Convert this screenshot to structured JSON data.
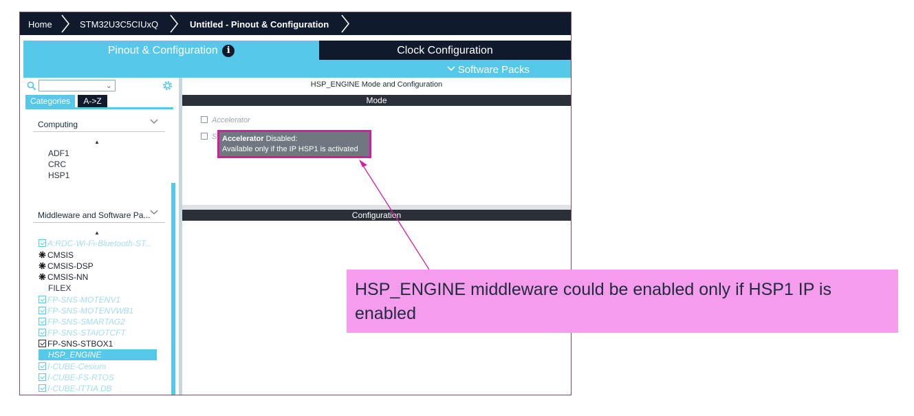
{
  "breadcrumb": {
    "home": "Home",
    "device": "STM32U3C5CIUxQ",
    "project": "Untitled - Pinout & Configuration"
  },
  "tabs": {
    "pinout": "Pinout & Configuration",
    "clock": "Clock Configuration",
    "software_packs": "Software Packs"
  },
  "left": {
    "search_placeholder": "",
    "category_tabs": {
      "categories": "Categories",
      "atoz": "A->Z"
    },
    "computing": {
      "title": "Computing",
      "items": [
        "ADF1",
        "CRC",
        "HSP1"
      ]
    },
    "middleware": {
      "title": "Middleware and Software Pa...",
      "items": [
        {
          "label": "A:RDC-Wi-Fi-Bluetooth-ST...",
          "state": "dim"
        },
        {
          "label": "CMSIS",
          "state": "gear"
        },
        {
          "label": "CMSIS-DSP",
          "state": "gear"
        },
        {
          "label": "CMSIS-NN",
          "state": "gear"
        },
        {
          "label": "FILEX",
          "state": "plain"
        },
        {
          "label": "FP-SNS-MOTENV1",
          "state": "dim"
        },
        {
          "label": "FP-SNS-MOTENVWB1",
          "state": "dim"
        },
        {
          "label": "FP-SNS-SMARTAG2",
          "state": "dim"
        },
        {
          "label": "FP-SNS-STAIOTCFT",
          "state": "dim"
        },
        {
          "label": "FP-SNS-STBOX1",
          "state": "dark"
        },
        {
          "label": "HSP_ENGINE",
          "state": "selected"
        },
        {
          "label": "I-CUBE-Cesium",
          "state": "dim"
        },
        {
          "label": "I-CUBE-FS-RTOS",
          "state": "dim"
        },
        {
          "label": "I-CUBE-ITTIA DB",
          "state": "dim"
        }
      ]
    }
  },
  "right": {
    "title": "HSP_ENGINE Mode and Configuration",
    "mode_label": "Mode",
    "checkbox_1": "Accelerator",
    "checkbox_2": "S",
    "tooltip": {
      "bold": "Accelerator",
      "rest": " Disabled:",
      "line2": "Available only if the IP HSP1 is activated"
    },
    "config_label": "Configuration"
  },
  "callout": {
    "text": "HSP_ENGINE middleware could be enabled only if HSP1 IP is enabled"
  },
  "colors": {
    "accent": "#56c8ea",
    "dark": "#0f1a2c",
    "callout_bg": "#f59ced",
    "highlight_border": "#d81aa0"
  }
}
